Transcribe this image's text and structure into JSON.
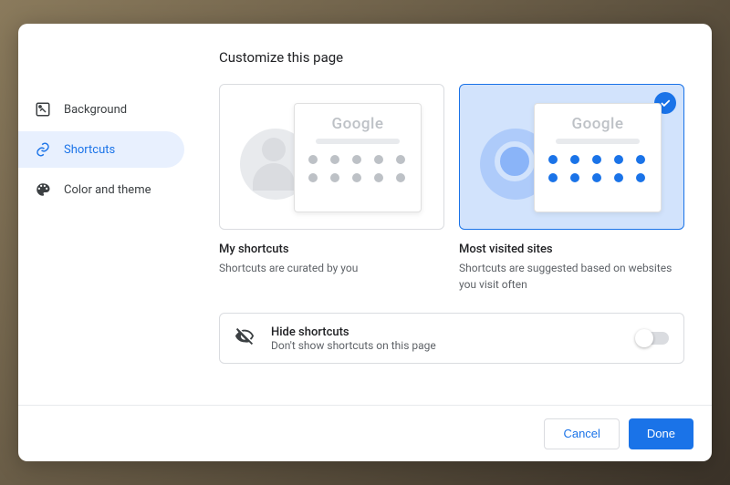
{
  "title": "Customize this page",
  "sidebar": {
    "items": [
      {
        "label": "Background"
      },
      {
        "label": "Shortcuts"
      },
      {
        "label": "Color and theme"
      }
    ],
    "active_index": 1
  },
  "preview_logo": "Google",
  "options": [
    {
      "title": "My shortcuts",
      "desc": "Shortcuts are curated by you",
      "selected": false
    },
    {
      "title": "Most visited sites",
      "desc": "Shortcuts are suggested based on websites you visit often",
      "selected": true
    }
  ],
  "hide": {
    "title": "Hide shortcuts",
    "desc": "Don't show shortcuts on this page",
    "on": false
  },
  "buttons": {
    "cancel": "Cancel",
    "done": "Done"
  }
}
